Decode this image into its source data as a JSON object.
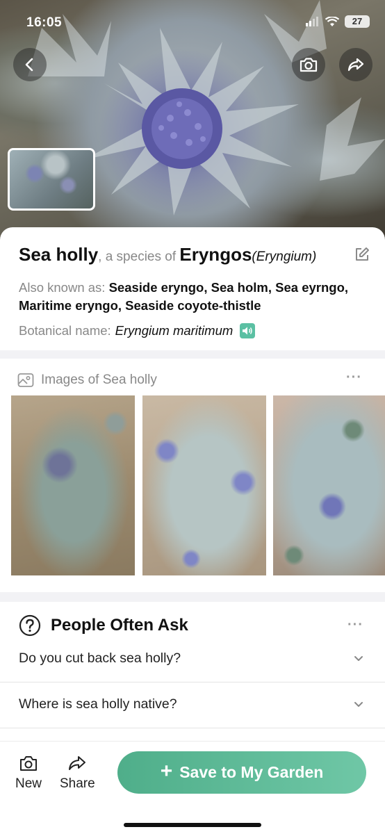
{
  "status_bar": {
    "time": "16:05",
    "battery": "27"
  },
  "hero": {
    "back_icon": "chevron-left-icon",
    "camera_icon": "camera-icon",
    "share_icon": "share-arrow-icon"
  },
  "plant": {
    "common_name": "Sea holly",
    "species_of_text": ", a species of ",
    "genus_common": "Eryngos",
    "genus_scientific": "(Eryngium)",
    "aka_label": "Also known as: ",
    "aka_names": "Seaside eryngo, Sea holm, Sea eyrngo, Maritime eryngo, Seaside coyote-thistle",
    "botanical_label": "Botanical name:",
    "botanical_name": "Eryngium maritimum"
  },
  "images_section": {
    "title": "Images of Sea holly",
    "more": "···"
  },
  "people_ask": {
    "title": "People Often Ask",
    "more": "···",
    "questions": [
      "Do you cut back sea holly?",
      "Where is sea holly native?"
    ]
  },
  "bottom_bar": {
    "new_label": "New",
    "share_label": "Share",
    "save_label": "Save to My Garden",
    "save_plus": "+"
  },
  "colors": {
    "accent_green": "#5bb896",
    "muted_text": "#888888"
  }
}
